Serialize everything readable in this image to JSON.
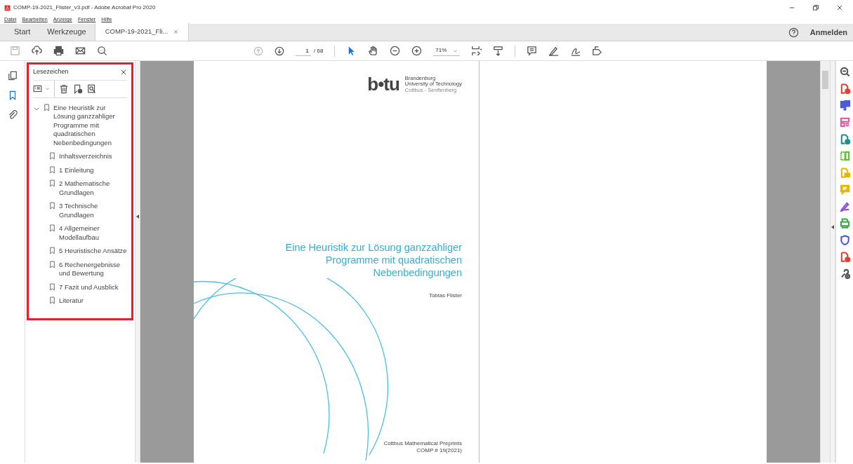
{
  "window": {
    "title": "COMP-19-2021_Flister_v3.pdf - Adobe Acrobat Pro 2020"
  },
  "menu": [
    "Datei",
    "Bearbeiten",
    "Anzeige",
    "Fenster",
    "Hilfe"
  ],
  "tabs": [
    {
      "label": "Start",
      "selected": false,
      "closable": false
    },
    {
      "label": "Werkzeuge",
      "selected": false,
      "closable": false
    },
    {
      "label": "COMP-19-2021_Fli...",
      "selected": true,
      "closable": true
    }
  ],
  "sign_in": "Anmelden",
  "toolbar_left": [
    {
      "kind": "save",
      "disabled": true
    },
    {
      "kind": "upload",
      "disabled": false
    },
    {
      "kind": "print",
      "disabled": false
    },
    {
      "kind": "mail",
      "disabled": false
    },
    {
      "kind": "find",
      "disabled": false
    }
  ],
  "nav": {
    "prev_disabled": true,
    "page": "1",
    "total": "/ 68",
    "zoom": "71%"
  },
  "toolbar_right": [
    {
      "kind": "select",
      "selected": true
    },
    {
      "kind": "hand",
      "selected": false
    },
    {
      "kind": "zoom-out",
      "selected": false
    },
    {
      "kind": "zoom-in",
      "selected": false
    }
  ],
  "toolbar_extra": [
    {
      "kind": "fit"
    },
    {
      "kind": "scroll"
    },
    {
      "kind": "comment"
    },
    {
      "kind": "highlight"
    },
    {
      "kind": "sign"
    },
    {
      "kind": "fill"
    }
  ],
  "side_icons": [
    {
      "kind": "pages",
      "selected": false
    },
    {
      "kind": "bookmarks",
      "selected": true
    },
    {
      "kind": "attachments",
      "selected": false
    }
  ],
  "bookmarks": {
    "title": "Lesezeichen",
    "highlighted": true,
    "items": [
      {
        "label": "Eine Heuristik zur Lösung ganzzahliger Programme mit quadratischen Nebenbedingungen",
        "expanded": true,
        "children": [
          {
            "label": "Inhaltsverzeichnis"
          },
          {
            "label": "1 Einleitung"
          },
          {
            "label": "2 Mathematische Grundlagen"
          },
          {
            "label": "3 Technische Grundlagen"
          },
          {
            "label": "4 Allgemeiner Modellaufbau"
          },
          {
            "label": "5 Heuristische Ansätze"
          },
          {
            "label": "6 Rechenergebnisse und Bewertung"
          },
          {
            "label": "7 Fazit und Ausblick"
          },
          {
            "label": "Literatur"
          }
        ]
      }
    ]
  },
  "document": {
    "logo_mark": "b•tu",
    "logo_lines": [
      "Brandenburg",
      "University of Technology",
      "Cottbus - Senftenberg"
    ],
    "title_lines": [
      "Eine Heuristik zur Lösung ganzzahliger",
      "Programme mit quadratischen",
      "Nebenbedingungen"
    ],
    "author": "Tobias Flister",
    "footer_lines": [
      "Cottbus Mathematical Preprints",
      "COMP # 19(2021)"
    ]
  },
  "right_tools": [
    {
      "kind": "search",
      "color": "#555555"
    },
    {
      "kind": "create",
      "color": "#e0413a"
    },
    {
      "kind": "combine",
      "color": "#4b5bd6"
    },
    {
      "kind": "organize",
      "color": "#e0569a"
    },
    {
      "kind": "export",
      "color": "#1f8f8f"
    },
    {
      "kind": "edit",
      "color": "#5eb936"
    },
    {
      "kind": "comment-file",
      "color": "#e5b800"
    },
    {
      "kind": "comment",
      "color": "#e5b800"
    },
    {
      "kind": "sign",
      "color": "#8a4fd8"
    },
    {
      "kind": "scan",
      "color": "#3aa84a"
    },
    {
      "kind": "protect",
      "color": "#4b5bd6"
    },
    {
      "kind": "redact",
      "color": "#e0413a"
    },
    {
      "kind": "more",
      "color": "#555555"
    }
  ]
}
